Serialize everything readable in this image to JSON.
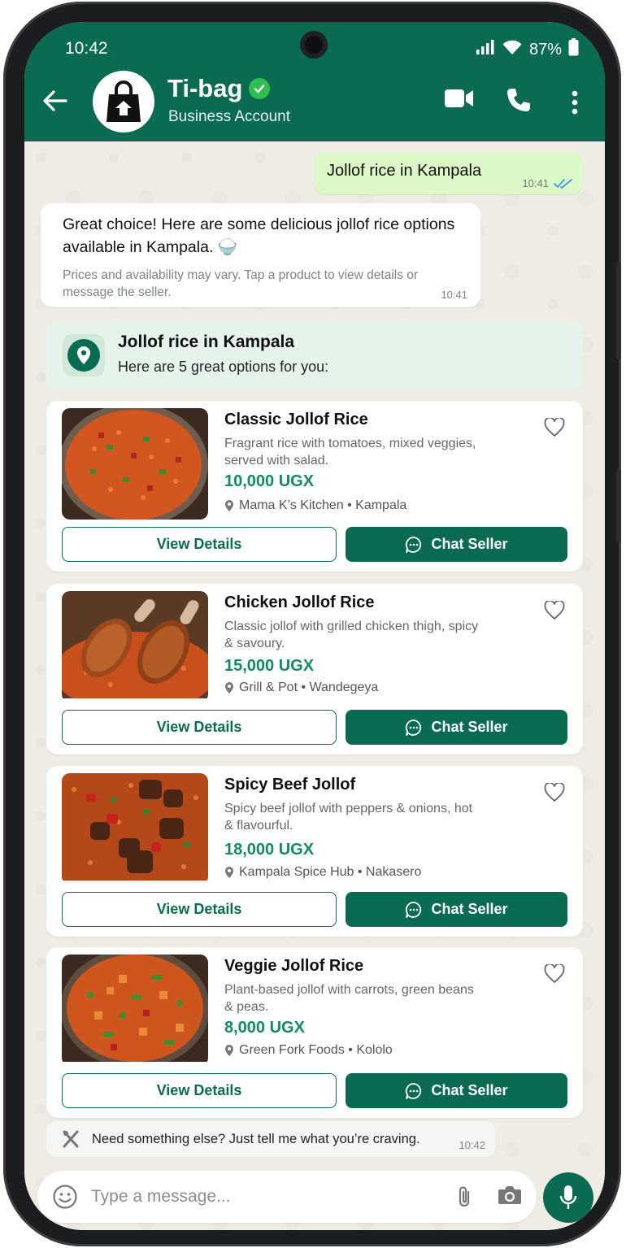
{
  "status_bar": {
    "time": "10:42",
    "battery": "87%"
  },
  "header": {
    "name": "Ti-bag",
    "subtitle": "Business Account"
  },
  "messages": {
    "outgoing": {
      "text": "Jollof rice in Kampala",
      "time": "10:41"
    },
    "incoming": {
      "text": "Great choice! Here are some delicious jollof rice options available in Kampala. 🍚",
      "note": "Prices and availability may vary. Tap a product to view details or message the seller.",
      "time": "10:41"
    }
  },
  "list_header": {
    "title": "Jollof rice in Kampala",
    "subtitle": "Here are 5 great options for you:"
  },
  "products": [
    {
      "name": "Classic Jollof Rice",
      "description": "Fragrant rice with tomatoes, mixed veggies, served with salad.",
      "price": "10,000 UGX",
      "location": "Mama K’s Kitchen • Kampala",
      "image": "jollof-with-veggies"
    },
    {
      "name": "Chicken Jollof Rice",
      "description": "Classic jollof with grilled chicken thigh, spicy & savoury.",
      "price": "15,000 UGX",
      "location": "Grill & Pot • Wandegeya",
      "image": "jollof-with-chicken"
    },
    {
      "name": "Spicy Beef Jollof",
      "description": "Spicy beef jollof with peppers & onions, hot & flavourful.",
      "price": "18,000 UGX",
      "location": "Kampala Spice Hub • Nakasero",
      "image": "jollof-with-beef"
    },
    {
      "name": "Veggie Jollof Rice",
      "description": "Plant-based jollof with carrots, green beans & peas.",
      "price": "8,000 UGX",
      "location": "Green Fork Foods • Kololo",
      "image": "jollof-with-vegetables"
    }
  ],
  "buttons": {
    "view_details": "View Details",
    "chat_seller": "Chat Seller"
  },
  "footer_message": {
    "text": "Need something else? Just tell me what you’re craving.",
    "time": "10:42"
  },
  "input": {
    "placeholder": "Type a message..."
  },
  "colors": {
    "brand": "#0b6b52",
    "price": "#128c5a",
    "outgoing_bubble": "#dcf8c6",
    "verified": "#2fbf4e"
  },
  "icons": [
    "back-arrow-icon",
    "verified-badge-icon",
    "video-call-icon",
    "phone-icon",
    "more-vertical-icon",
    "location-pin-icon",
    "heart-icon",
    "chat-bubble-icon",
    "fork-knife-icon",
    "emoji-icon",
    "paperclip-icon",
    "camera-icon",
    "mic-icon",
    "double-check-icon"
  ]
}
